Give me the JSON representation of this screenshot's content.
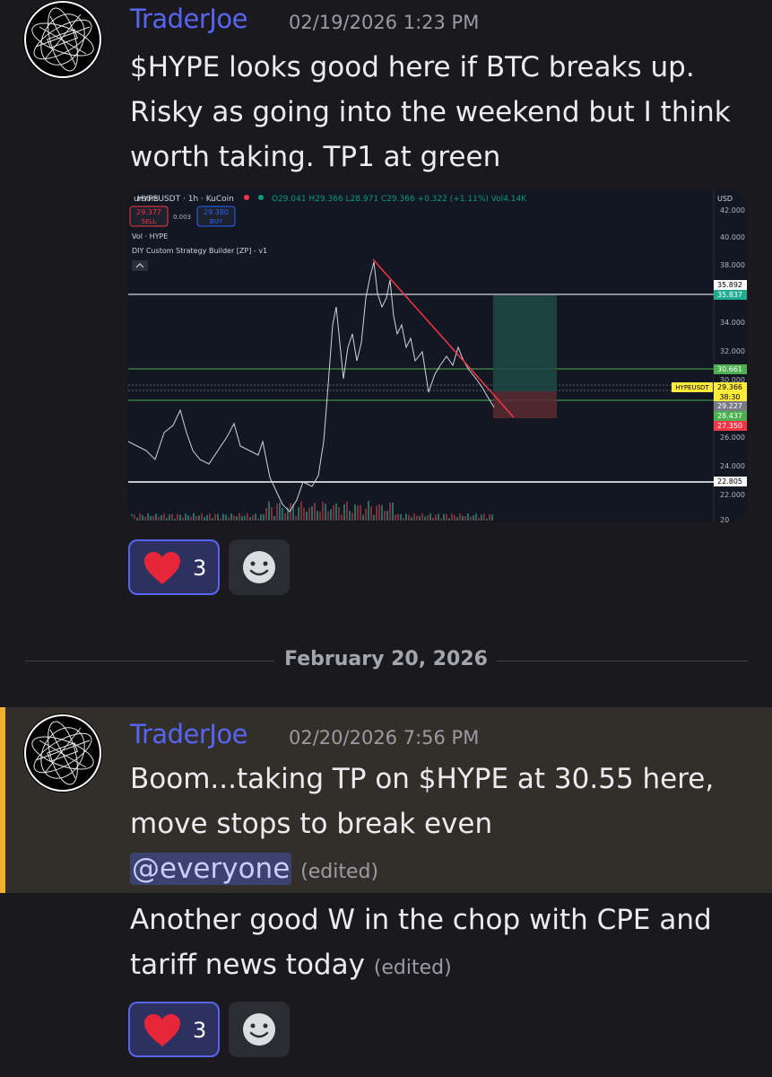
{
  "messages": [
    {
      "author": "TraderJoe",
      "timestamp": "02/19/2026 1:23 PM",
      "text_lines": [
        "$HYPE looks good here if BTC breaks up.",
        "Risky as going into the weekend but I think",
        "worth taking. TP1 at green"
      ],
      "reaction": {
        "emoji": "heart-icon",
        "count": "3"
      }
    },
    {
      "author": "TraderJoe",
      "timestamp": "02/20/2026 7:56 PM",
      "text_lines": [
        "Boom...taking TP on $HYPE at 30.55 here,",
        "move stops to break even"
      ],
      "mention": "@everyone",
      "edited_label": "(edited)"
    },
    {
      "text_lines": [
        "Another good W in the chop with CPE and",
        "tariff news today"
      ],
      "edited_label": "(edited)",
      "reaction": {
        "emoji": "heart-icon",
        "count": "3"
      }
    }
  ],
  "date_divider": "February 20, 2026",
  "chart": {
    "symbol": "HYPEUSDT",
    "interval": "1h",
    "exchange": "KuCoin",
    "ohlc": "O29.041 H29.366 L28.971 C29.366 +0.322 (+1.11%) Vol4.14K",
    "ohlc_prefix": "HYPEUSDT · 1h · KuCoin",
    "sell_price": "29.377",
    "sell_label": "SELL",
    "spread": "0.003",
    "buy_price": "29.380",
    "buy_label": "BUY",
    "cursor_label": "ursors",
    "currency": "USD",
    "indicator_1": "Vol · HYPE",
    "indicator_2": "DIY Custom Strategy Builder [ZP] - v1",
    "collapse_icon": "chevron-up-icon",
    "y_ticks": [
      "40.000",
      "38.000",
      "34.000",
      "32.000",
      "30.000",
      "26.000",
      "24.000",
      "22.000"
    ],
    "price_tags": [
      {
        "value": "35.892",
        "color": "#ffffff",
        "text_color": "#000000"
      },
      {
        "value": "35.837",
        "color": "#22ab94",
        "text_color": "#ffffff"
      },
      {
        "value": "30.661",
        "color": "#4caf50",
        "text_color": "#ffffff"
      },
      {
        "value": "29.366",
        "color": "#ffeb3b",
        "text_color": "#000000"
      },
      {
        "value": "38:30",
        "color": "#ffeb3b",
        "text_color": "#000000"
      },
      {
        "value": "29.227",
        "color": "#787b86",
        "text_color": "#ffffff"
      },
      {
        "value": "28.437",
        "color": "#4caf50",
        "text_color": "#ffffff"
      },
      {
        "value": "27.350",
        "color": "#f23645",
        "text_color": "#ffffff"
      },
      {
        "value": "22.805",
        "color": "#ffffff",
        "text_color": "#000000"
      }
    ],
    "symbol_tag": "HYPEUSDT",
    "top_tick": "42.000",
    "bottom_tick": "20"
  },
  "colors": {
    "accent": "#5865f2",
    "heart": "#e7263a",
    "highlight_bar": "#f0b132"
  }
}
